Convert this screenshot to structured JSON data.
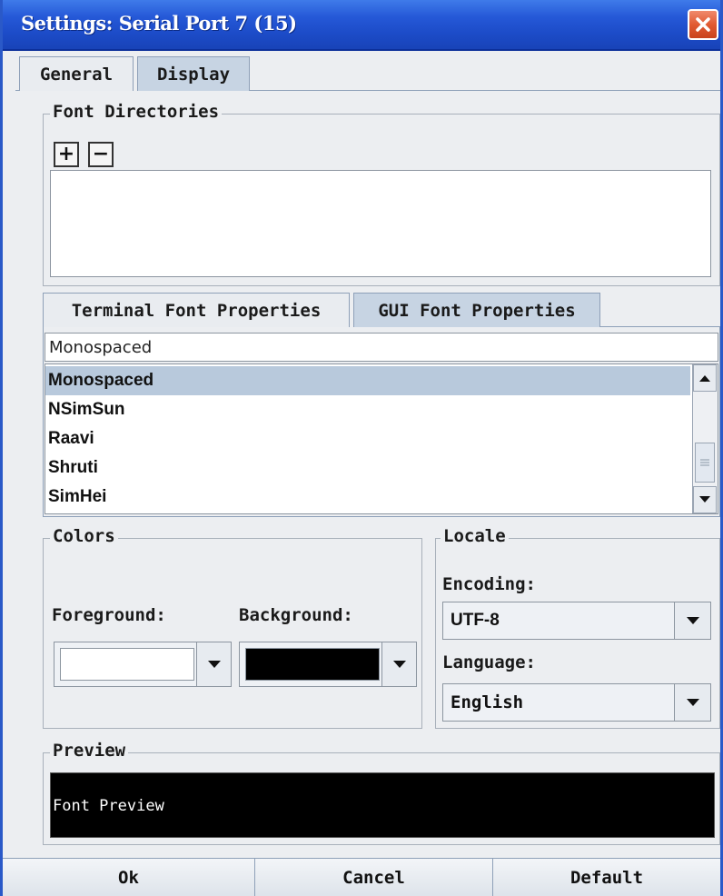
{
  "window": {
    "title": "Settings: Serial Port 7 (15)"
  },
  "tabs": [
    {
      "label": "General",
      "selected": false
    },
    {
      "label": "Display",
      "selected": true
    }
  ],
  "font_directories": {
    "legend": "Font Directories",
    "add_label": "+",
    "remove_label": "−"
  },
  "font_tabs": [
    {
      "label": "Terminal Font Properties",
      "selected": false
    },
    {
      "label": "GUI Font Properties",
      "selected": true
    }
  ],
  "font_search": {
    "value": "Monospaced"
  },
  "font_list": {
    "items": [
      "Monospaced",
      "NSimSun",
      "Raavi",
      "Shruti",
      "SimHei"
    ],
    "selected_index": 0
  },
  "colors": {
    "legend": "Colors",
    "foreground_label": "Foreground:",
    "background_label": "Background:",
    "foreground_color": "#ffffff",
    "background_color": "#000000"
  },
  "locale": {
    "legend": "Locale",
    "encoding_label": "Encoding:",
    "encoding_value": "UTF-8",
    "language_label": "Language:",
    "language_value": "English"
  },
  "preview": {
    "legend": "Preview",
    "text": "Font Preview"
  },
  "buttons": {
    "ok": "Ok",
    "cancel": "Cancel",
    "default": "Default"
  }
}
